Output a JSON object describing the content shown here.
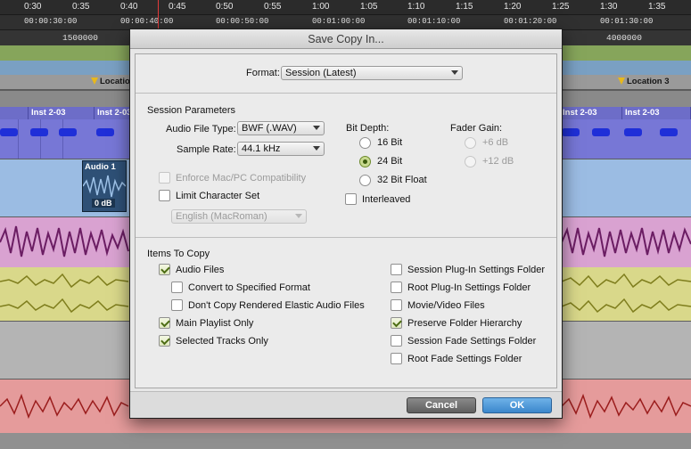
{
  "daw": {
    "bar_ticks": [
      "0:30",
      "0:35",
      "0:40",
      "0:45",
      "0:50",
      "0:55",
      "1:00",
      "1:05",
      "1:10",
      "1:15",
      "1:20",
      "1:25",
      "1:30",
      "1:35"
    ],
    "minsec_ticks": [
      "00:00:30:00",
      "00:00:40:00",
      "00:00:50:00",
      "00:01:00:00",
      "00:01:10:00",
      "00:01:20:00",
      "00:01:30:00"
    ],
    "sample_ticks": [
      "1500000",
      "4000000"
    ],
    "markers": [
      "Location",
      "Location 3"
    ],
    "midi_clips": [
      "Inst 2-03",
      "Inst 2-03",
      "Inst 2-03",
      "Inst 2-03"
    ],
    "audio_clip": {
      "label": "Audio 1",
      "gain": "0 dB"
    }
  },
  "dialog": {
    "title": "Save Copy In...",
    "format_label": "Format:",
    "format_value": "Session (Latest)",
    "session_params_title": "Session Parameters",
    "audio_file_type_label": "Audio File Type:",
    "audio_file_type_value": "BWF (.WAV)",
    "sample_rate_label": "Sample Rate:",
    "sample_rate_value": "44.1 kHz",
    "enforce_label": "Enforce Mac/PC Compatibility",
    "limit_charset_label": "Limit Character Set",
    "charset_value": "English (MacRoman)",
    "bit_depth_label": "Bit Depth:",
    "bit_16": "16 Bit",
    "bit_24": "24 Bit",
    "bit_32": "32 Bit Float",
    "interleaved_label": "Interleaved",
    "fader_gain_label": "Fader Gain:",
    "fader_6": "+6 dB",
    "fader_12": "+12 dB",
    "items_title": "Items To Copy",
    "items_left": [
      {
        "label": "Audio Files",
        "checked": true
      },
      {
        "label": "Convert to Specified Format",
        "checked": false
      },
      {
        "label": "Don't Copy Rendered Elastic Audio Files",
        "checked": false
      },
      {
        "label": "Main Playlist Only",
        "checked": true
      },
      {
        "label": "Selected Tracks Only",
        "checked": true
      }
    ],
    "items_right": [
      {
        "label": "Session Plug-In Settings Folder",
        "checked": false
      },
      {
        "label": "Root Plug-In Settings Folder",
        "checked": false
      },
      {
        "label": "Movie/Video Files",
        "checked": false
      },
      {
        "label": "Preserve Folder Hierarchy",
        "checked": true
      },
      {
        "label": "Session Fade Settings Folder",
        "checked": false
      },
      {
        "label": "Root Fade Settings Folder",
        "checked": false
      }
    ],
    "cancel_label": "Cancel",
    "ok_label": "OK"
  }
}
